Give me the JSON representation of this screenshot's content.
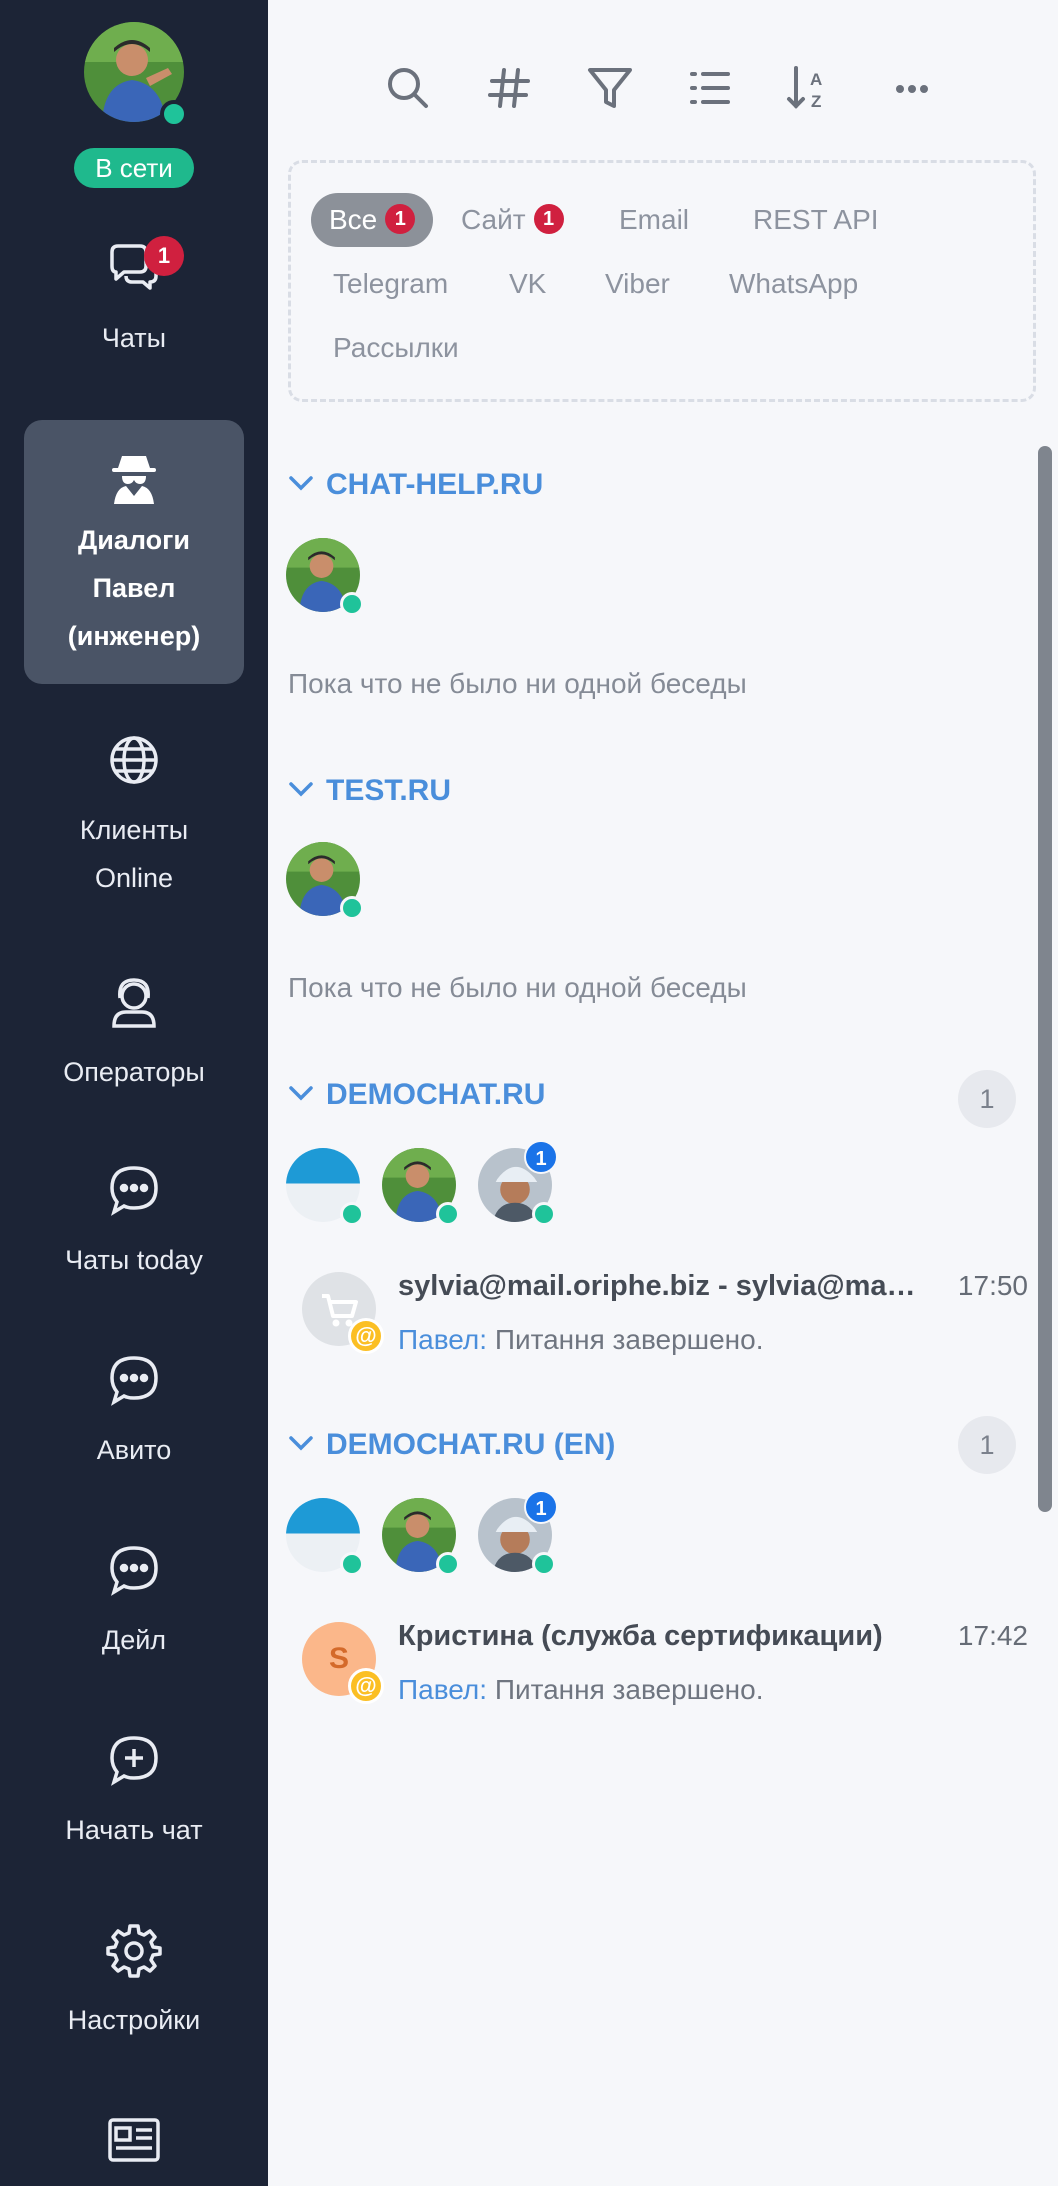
{
  "sidebar": {
    "status": "В сети",
    "items": [
      {
        "label": "Чаты",
        "badge": "1"
      },
      {
        "label_lines": [
          "Диалоги",
          "Павел",
          "(инженер)"
        ]
      },
      {
        "label_lines": [
          "Клиенты",
          "Online"
        ]
      },
      {
        "label": "Операторы"
      },
      {
        "label": "Чаты today"
      },
      {
        "label": "Авито"
      },
      {
        "label": "Дейл"
      },
      {
        "label": "Начать чат"
      },
      {
        "label": "Настройки"
      }
    ]
  },
  "filters": {
    "chips": [
      {
        "label": "Все",
        "badge": "1"
      },
      {
        "label": "Сайт",
        "badge": "1"
      },
      {
        "label": "Email"
      },
      {
        "label": "REST API"
      },
      {
        "label": "Telegram"
      },
      {
        "label": "VK"
      },
      {
        "label": "Viber"
      },
      {
        "label": "WhatsApp"
      },
      {
        "label": "Рассылки"
      }
    ]
  },
  "groups": [
    {
      "name": "CHAT-HELP.RU",
      "empty": "Пока что не было ни одной беседы"
    },
    {
      "name": "TEST.RU",
      "empty": "Пока что не было ни одной беседы"
    },
    {
      "name": "DEMOCHAT.RU",
      "count": "1",
      "operator_badge": "1",
      "conversation": {
        "title": "sylvia@mail.oriphe.biz - sylvia@mail.oriphe.biz",
        "time": "17:50",
        "author": "Павел:",
        "message": "Питання завершено."
      }
    },
    {
      "name": "DEMOCHAT.RU (EN)",
      "count": "1",
      "operator_badge": "1",
      "conversation": {
        "title": "Кристина (служба сертификации)",
        "avatar_letter": "S",
        "time": "17:42",
        "author": "Павел:",
        "message": "Питання завершено."
      }
    }
  ],
  "colors": {
    "sidebar_bg": "#1c2436",
    "online": "#1fc39a",
    "accent": "#4a8edb",
    "badge_red": "#d0203f"
  }
}
